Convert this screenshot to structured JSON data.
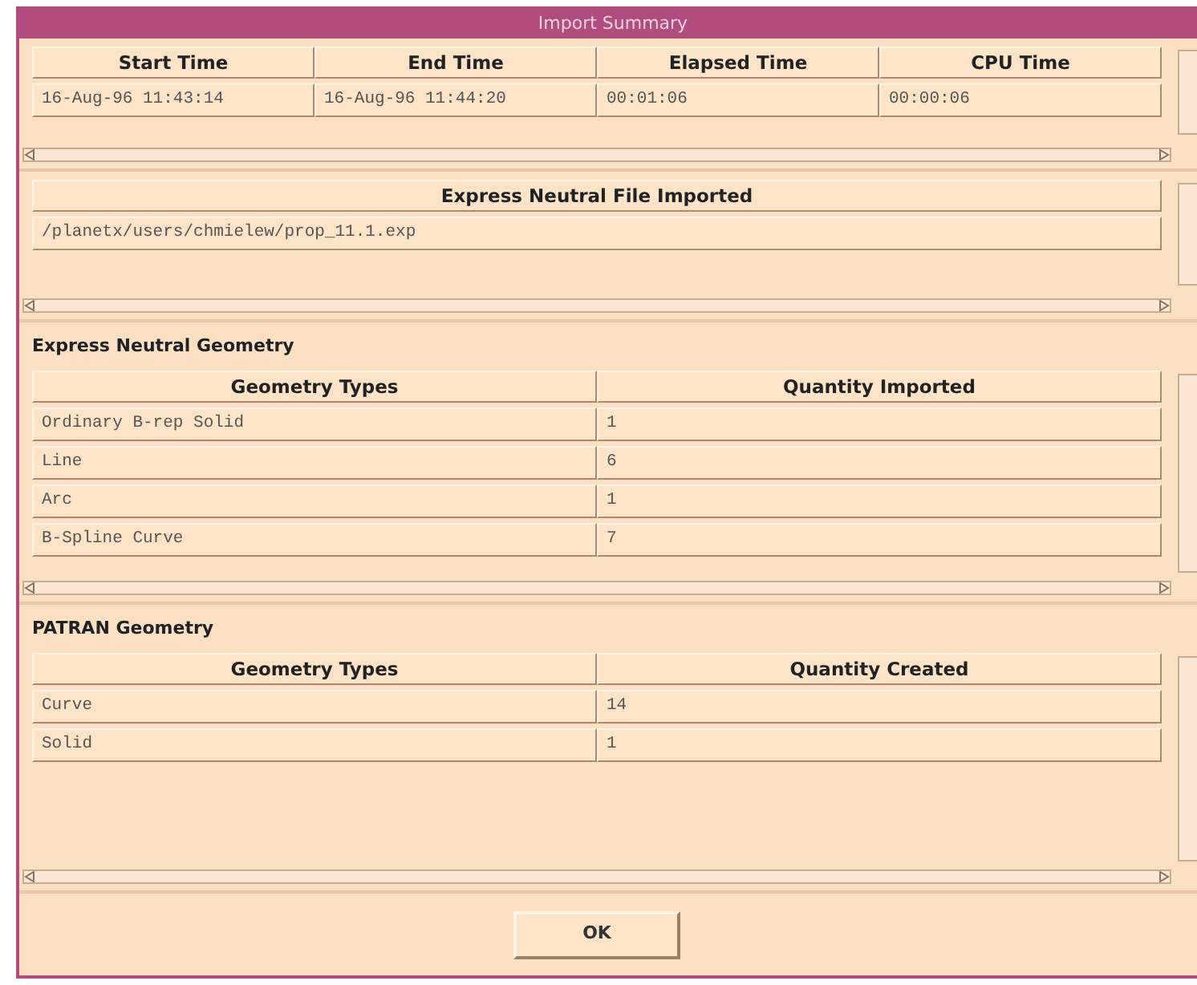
{
  "window": {
    "title": "Import Summary"
  },
  "times": {
    "columns": [
      "Start Time",
      "End Time",
      "Elapsed Time",
      "CPU Time"
    ],
    "rows": [
      [
        "16-Aug-96 11:43:14",
        "16-Aug-96 11:44:20",
        "00:01:06",
        "00:00:06"
      ]
    ]
  },
  "file": {
    "columns": [
      "Express Neutral File Imported"
    ],
    "rows": [
      [
        "/planetx/users/chmielew/prop_11.1.exp"
      ]
    ]
  },
  "neutral_geometry": {
    "title": "Express Neutral Geometry",
    "columns": [
      "Geometry Types",
      "Quantity Imported"
    ],
    "rows": [
      [
        "Ordinary B-rep Solid",
        "1"
      ],
      [
        "Line",
        "6"
      ],
      [
        "Arc",
        "1"
      ],
      [
        "B-Spline Curve",
        "7"
      ]
    ]
  },
  "patran_geometry": {
    "title": "PATRAN Geometry",
    "columns": [
      "Geometry Types",
      "Quantity Created"
    ],
    "rows": [
      [
        "Curve",
        "14"
      ],
      [
        "Solid",
        "1"
      ]
    ]
  },
  "buttons": [
    "OK"
  ]
}
